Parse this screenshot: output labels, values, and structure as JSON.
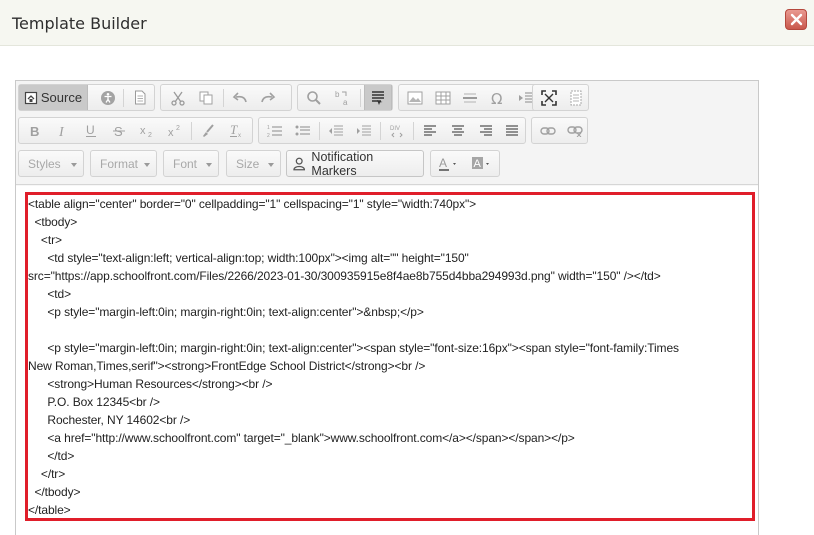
{
  "dialog": {
    "title": "Template Builder"
  },
  "toolbar": {
    "source_label": "Source",
    "styles_label": "Styles",
    "format_label": "Format",
    "font_label": "Font",
    "size_label": "Size",
    "notification_markers_label": "Notification Markers"
  },
  "source": {
    "lines": [
      "<table align=\"center\" border=\"0\" cellpadding=\"1\" cellspacing=\"1\" style=\"width:740px\">",
      "  <tbody>",
      "    <tr>",
      "      <td style=\"text-align:left; vertical-align:top; width:100px\"><img alt=\"\" height=\"150\"",
      "src=\"https://app.schoolfront.com/Files/2266/2023-01-30/300935915e8f4ae8b755d4bba294993d.png\" width=\"150\" /></td>",
      "      <td>",
      "      <p style=\"margin-left:0in; margin-right:0in; text-align:center\">&nbsp;</p>",
      "",
      "      <p style=\"margin-left:0in; margin-right:0in; text-align:center\"><span style=\"font-size:16px\"><span style=\"font-family:Times",
      "New Roman,Times,serif\"><strong>FrontEdge School District</strong><br />",
      "      <strong>Human Resources</strong><br />",
      "      P.O. Box 12345<br />",
      "      Rochester, NY 14602<br />",
      "      <a href=\"http://www.schoolfront.com\" target=\"_blank\">www.schoolfront.com</a></span></span></p>",
      "      </td>",
      "    </tr>",
      "  </tbody>",
      "</table>"
    ]
  }
}
